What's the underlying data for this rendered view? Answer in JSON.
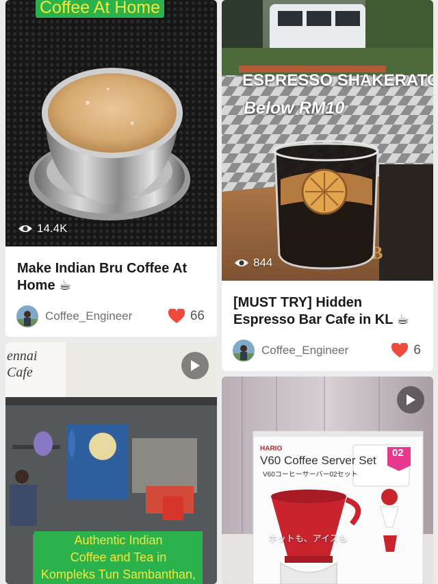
{
  "posts": [
    {
      "cover_text": "Coffee At Home",
      "views": "14.4K",
      "title_line1": "Make Indian Bru Coffee At",
      "title_line2": "Home ☕",
      "author": "Coffee_Engineer",
      "likes": "66"
    },
    {
      "cover_text_1": "ESPRESSO SHAKERATO",
      "cover_text_2": "Below RM10",
      "views": "844",
      "title_line1": "[MUST TRY] Hidden",
      "title_line2": "Espresso Bar Cafe in KL ☕",
      "author": "Coffee_Engineer",
      "likes": "6"
    },
    {
      "cover_text_1": "Authentic Indian",
      "cover_text_2": "Coffee and Tea in",
      "cover_text_3": "Kompleks Tun Sambanthan,",
      "sign_text_1": "ennai",
      "sign_text_2": "Cafe"
    },
    {
      "box_brand": "HARIO",
      "box_title": "V60 Coffee Server Set",
      "box_subtitle": "V60コーヒーサーバー02セット",
      "box_badge": "02",
      "box_caption": "ホットも、アイスも"
    }
  ],
  "colors": {
    "heart": "#f04a3e",
    "caption_green_bg": "#2bb24c",
    "caption_yellow_text": "#f5e83a"
  },
  "icons": [
    "eye-icon",
    "heart-icon",
    "play-icon",
    "avatar"
  ]
}
